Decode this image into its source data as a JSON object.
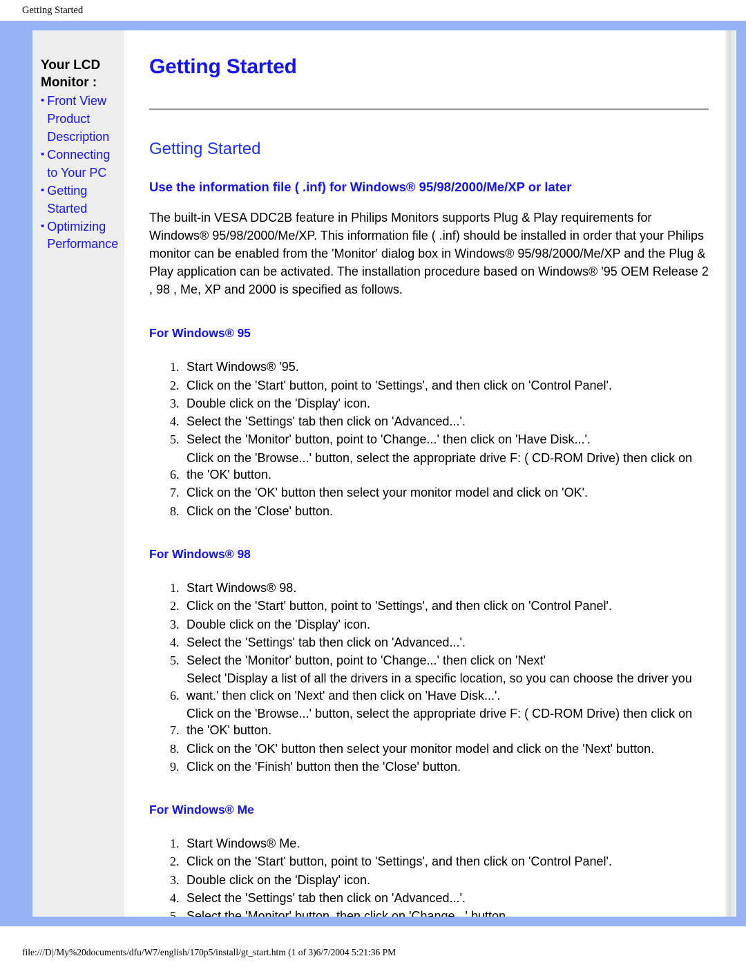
{
  "print_header": {
    "title": "Getting Started"
  },
  "print_footer": {
    "text": "file:///D|/My%20documents/dfu/W7/english/170p5/install/gt_start.htm (1 of 3)6/7/2004 5:21:36 PM"
  },
  "colors": {
    "frame_blue": "#96b4f5",
    "link_blue": "#1414ff",
    "heading_blue": "#1e32ff",
    "sidebar_bg": "#eeeeee",
    "rule_gray": "#9c9c9c"
  },
  "sidebar": {
    "title": "Your LCD\nMonitor :",
    "bullet": "•",
    "items": [
      {
        "label": "Front View Product Description"
      },
      {
        "label": "Connecting to Your PC"
      },
      {
        "label": "Getting Started"
      },
      {
        "label": "Optimizing Performance"
      }
    ]
  },
  "main": {
    "title": "Getting Started",
    "subtitle": "Getting Started",
    "section_heading": "Use the information file ( .inf) for Windows® 95/98/2000/Me/XP or later",
    "intro_paragraph": "The built-in VESA DDC2B feature in Philips Monitors supports Plug & Play requirements for Windows® 95/98/2000/Me/XP. This information file ( .inf) should be installed in order that your Philips monitor can be enabled from the 'Monitor' dialog box in Windows® 95/98/2000/Me/XP and the Plug & Play application can be activated. The installation procedure based on Windows® '95 OEM Release 2 , 98 , Me, XP and 2000 is specified as follows.",
    "sections": [
      {
        "heading": "For Windows® 95",
        "steps": [
          "Start Windows® '95.",
          "Click on the 'Start' button, point to 'Settings', and then click on 'Control Panel'.",
          "Double click on the 'Display' icon.",
          "Select the 'Settings' tab then click on 'Advanced...'.",
          "Select the 'Monitor' button, point to 'Change...' then click on 'Have Disk...'.",
          "Click on the 'Browse...' button, select the appropriate drive F: ( CD-ROM Drive) then click on the 'OK' button.",
          "Click on the 'OK' button then select your monitor model and click on 'OK'.",
          "Click on the 'Close' button."
        ]
      },
      {
        "heading": "For Windows® 98",
        "steps": [
          "Start Windows® 98.",
          "Click on the 'Start' button, point to 'Settings', and then click on 'Control Panel'.",
          "Double click on the 'Display' icon.",
          "Select the 'Settings' tab then click on 'Advanced...'.",
          "Select the 'Monitor' button, point to 'Change...' then click on 'Next'",
          "Select 'Display a list of all the drivers in a specific location, so you can choose the driver you want.' then click on 'Next' and then click on 'Have Disk...'.",
          "Click on the 'Browse...' button, select the appropriate drive F: ( CD-ROM Drive) then click on the 'OK' button.",
          "Click on the 'OK' button then select your monitor model and click on the 'Next' button.",
          "Click on the 'Finish' button then the 'Close' button."
        ]
      },
      {
        "heading": "For Windows® Me",
        "steps": [
          "Start Windows® Me.",
          "Click on the 'Start' button, point to 'Settings', and then click on 'Control Panel'.",
          "Double click on the 'Display' icon.",
          "Select the 'Settings' tab then click on 'Advanced...'.",
          "Select the 'Monitor' button, then click on 'Change...' button."
        ]
      }
    ]
  }
}
